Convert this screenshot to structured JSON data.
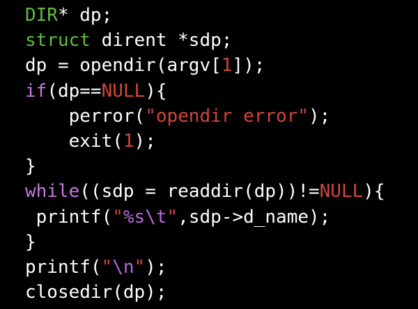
{
  "colors": {
    "background": "#000000",
    "plain": "#ffffff",
    "type": "#5fbf3f",
    "keyword": "#c678dd",
    "literal": "#d1463a",
    "escape": "#b968e0"
  },
  "code": {
    "lines": [
      [
        {
          "t": "DIR",
          "k": "type"
        },
        {
          "t": "* dp;",
          "k": "plain"
        }
      ],
      [
        {
          "t": "struct",
          "k": "type"
        },
        {
          "t": " dirent *sdp;",
          "k": "plain"
        }
      ],
      [
        {
          "t": "dp = opendir(argv[",
          "k": "plain"
        },
        {
          "t": "1",
          "k": "num"
        },
        {
          "t": "]);",
          "k": "plain"
        }
      ],
      [
        {
          "t": "if",
          "k": "kw"
        },
        {
          "t": "(dp==",
          "k": "plain"
        },
        {
          "t": "NULL",
          "k": "null"
        },
        {
          "t": "){",
          "k": "plain"
        }
      ],
      [
        {
          "t": "    perror(",
          "k": "plain"
        },
        {
          "t": "\"opendir error\"",
          "k": "str"
        },
        {
          "t": ");",
          "k": "plain"
        }
      ],
      [
        {
          "t": "    exit(",
          "k": "plain"
        },
        {
          "t": "1",
          "k": "num"
        },
        {
          "t": ");",
          "k": "plain"
        }
      ],
      [
        {
          "t": "}",
          "k": "plain"
        }
      ],
      [
        {
          "t": "while",
          "k": "kw"
        },
        {
          "t": "((sdp = readdir(dp))!=",
          "k": "plain"
        },
        {
          "t": "NULL",
          "k": "null"
        },
        {
          "t": "){",
          "k": "plain"
        }
      ],
      [
        {
          "t": " printf(",
          "k": "plain"
        },
        {
          "t": "\"",
          "k": "str"
        },
        {
          "t": "%s\\t",
          "k": "esc"
        },
        {
          "t": "\"",
          "k": "str"
        },
        {
          "t": ",sdp->d_name);",
          "k": "plain"
        }
      ],
      [
        {
          "t": "}",
          "k": "plain"
        }
      ],
      [
        {
          "t": "printf(",
          "k": "plain"
        },
        {
          "t": "\"",
          "k": "str"
        },
        {
          "t": "\\n",
          "k": "esc"
        },
        {
          "t": "\"",
          "k": "str"
        },
        {
          "t": ");",
          "k": "plain"
        }
      ],
      [
        {
          "t": "closedir(dp);",
          "k": "plain"
        }
      ]
    ]
  }
}
